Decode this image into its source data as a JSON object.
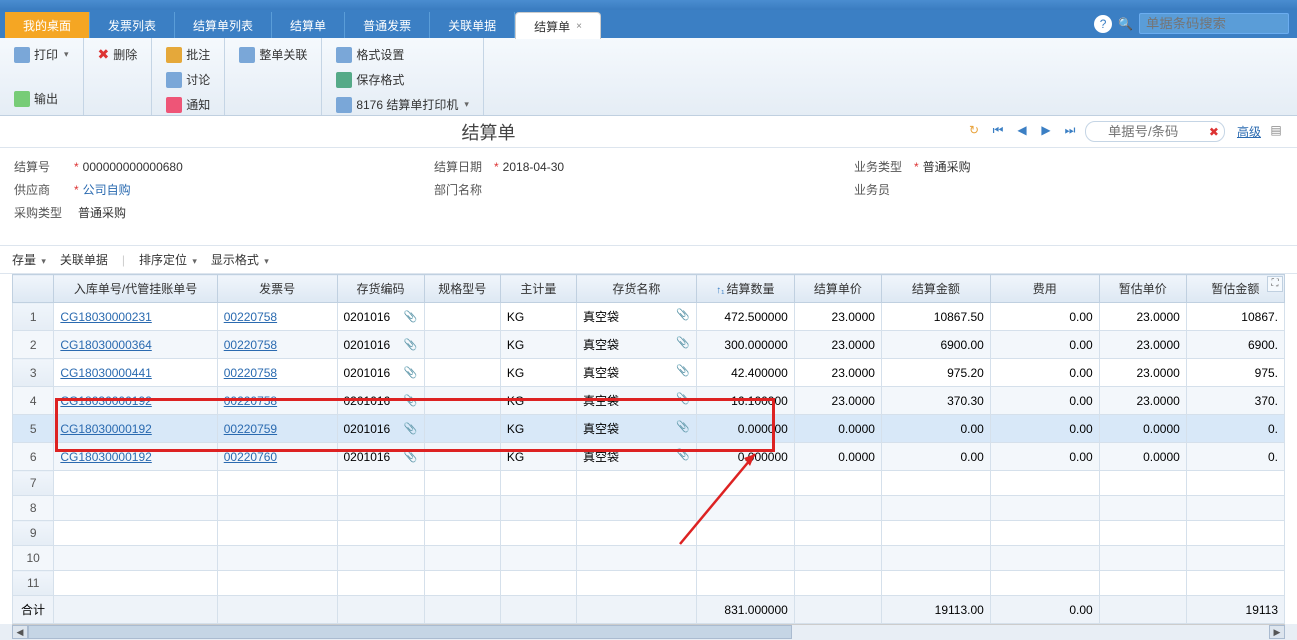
{
  "tabs": {
    "desktop": "我的桌面",
    "invoice_list": "发票列表",
    "settle_list": "结算单列表",
    "settle": "结算单",
    "normal_invoice": "普通发票",
    "related_doc": "关联单据",
    "settle_active": "结算单"
  },
  "top_search_placeholder": "单据条码搜索",
  "toolbar": {
    "print": "打印",
    "delete": "删除",
    "output": "输出",
    "note": "批注",
    "discuss": "讨论",
    "notify": "通知",
    "full_link": "整单关联",
    "format": "格式设置",
    "save_format": "保存格式",
    "template": "8176 结算单打印机"
  },
  "page_title": "结算单",
  "nav": {
    "search_placeholder": "单据号/条码",
    "advanced": "高级"
  },
  "form": {
    "settle_no_label": "结算号",
    "settle_no": "000000000000680",
    "supplier_label": "供应商",
    "supplier": "公司自购",
    "purchase_type_label": "采购类型",
    "purchase_type": "普通采购",
    "settle_date_label": "结算日期",
    "settle_date": "2018-04-30",
    "dept_label": "部门名称",
    "dept": "",
    "biz_type_label": "业务类型",
    "biz_type": "普通采购",
    "clerk_label": "业务员",
    "clerk": ""
  },
  "grid_toolbar": {
    "stock": "存量",
    "related": "关联单据",
    "sort": "排序定位",
    "display": "显示格式"
  },
  "columns": {
    "doc_no": "入库单号/代管挂账单号",
    "invoice_no": "发票号",
    "stock_code": "存货编码",
    "spec": "规格型号",
    "unit": "主计量",
    "stock_name": "存货名称",
    "qty": "结算数量",
    "price": "结算单价",
    "amount": "结算金额",
    "fee": "费用",
    "est_price": "暂估单价",
    "est_amount": "暂估金额"
  },
  "rows": [
    {
      "n": "1",
      "doc": "CG18030000231",
      "inv": "00220758",
      "code": "0201016",
      "unit": "KG",
      "name": "真空袋",
      "qty": "472.500000",
      "price": "23.0000",
      "amount": "10867.50",
      "fee": "0.00",
      "ep": "23.0000",
      "ea": "10867."
    },
    {
      "n": "2",
      "doc": "CG18030000364",
      "inv": "00220758",
      "code": "0201016",
      "unit": "KG",
      "name": "真空袋",
      "qty": "300.000000",
      "price": "23.0000",
      "amount": "6900.00",
      "fee": "0.00",
      "ep": "23.0000",
      "ea": "6900."
    },
    {
      "n": "3",
      "doc": "CG18030000441",
      "inv": "00220758",
      "code": "0201016",
      "unit": "KG",
      "name": "真空袋",
      "qty": "42.400000",
      "price": "23.0000",
      "amount": "975.20",
      "fee": "0.00",
      "ep": "23.0000",
      "ea": "975."
    },
    {
      "n": "4",
      "doc": "CG18030000192",
      "inv": "00220758",
      "code": "0201016",
      "unit": "KG",
      "name": "真空袋",
      "qty": "16.100000",
      "price": "23.0000",
      "amount": "370.30",
      "fee": "0.00",
      "ep": "23.0000",
      "ea": "370."
    },
    {
      "n": "5",
      "doc": "CG18030000192",
      "inv": "00220759",
      "code": "0201016",
      "unit": "KG",
      "name": "真空袋",
      "qty": "0.000000",
      "price": "0.0000",
      "amount": "0.00",
      "fee": "0.00",
      "ep": "0.0000",
      "ea": "0."
    },
    {
      "n": "6",
      "doc": "CG18030000192",
      "inv": "00220760",
      "code": "0201016",
      "unit": "KG",
      "name": "真空袋",
      "qty": "0.000000",
      "price": "0.0000",
      "amount": "0.00",
      "fee": "0.00",
      "ep": "0.0000",
      "ea": "0."
    }
  ],
  "empty_rows": [
    "7",
    "8",
    "9",
    "10",
    "11"
  ],
  "total": {
    "label": "合计",
    "qty": "831.000000",
    "amount": "19113.00",
    "fee": "0.00",
    "ea": "19113"
  }
}
